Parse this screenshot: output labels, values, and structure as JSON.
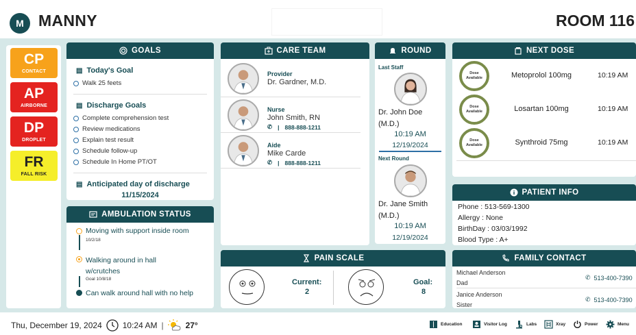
{
  "header": {
    "avatar_letter": "M",
    "patient_name": "MANNY",
    "room": "ROOM 116"
  },
  "flags": [
    {
      "code": "CP",
      "label": "CONTACT",
      "bg": "#f7a21b",
      "fg": "#ffffff"
    },
    {
      "code": "AP",
      "label": "AIRBORNE",
      "bg": "#e42320",
      "fg": "#ffffff"
    },
    {
      "code": "DP",
      "label": "DROPLET",
      "bg": "#e42320",
      "fg": "#ffffff"
    },
    {
      "code": "FR",
      "label": "FALL RISK",
      "bg": "#f5ee2a",
      "fg": "#222222"
    }
  ],
  "goals": {
    "title": "GOALS",
    "today_title": "Today's Goal",
    "today_items": [
      "Walk 25 feets"
    ],
    "discharge_title": "Discharge Goals",
    "discharge_items": [
      "Complete comprehension test",
      "Review medications",
      "Explain test result",
      "Schedule follow-up",
      "Schedule In Home PT/OT"
    ],
    "anticipated_title": "Anticipated day of discharge",
    "anticipated_date": "11/15/2024"
  },
  "ambulation": {
    "title": "AMBULATION STATUS",
    "items": [
      {
        "text": "Moving with support inside room",
        "sub": "10/2/18"
      },
      {
        "text": "Walking around in hall w/crutches",
        "sub": "Goal 10/8/18"
      },
      {
        "text": "Can walk around hall with no help",
        "sub": ""
      }
    ]
  },
  "care_team": {
    "title": "CARE TEAM",
    "members": [
      {
        "role": "Provider",
        "name": "Dr. Gardner, M.D.",
        "phone": ""
      },
      {
        "role": "Nurse",
        "name": "John Smith, RN",
        "phone": "888-888-1211"
      },
      {
        "role": "Aide",
        "name": "Mike Carde",
        "phone": "888-888-1211"
      }
    ]
  },
  "round": {
    "title": "ROUND",
    "last_label": "Last Staff",
    "last_name": "Dr. John Doe (M.D.)",
    "last_time": "10:19 AM",
    "last_date": "12/19/2024",
    "next_label": "Next Round",
    "next_name": "Dr. Jane Smith (M.D.)",
    "next_time": "10:19 AM",
    "next_date": "12/19/2024"
  },
  "next_dose": {
    "title": "NEXT DOSE",
    "ring_text": "Dose Available",
    "doses": [
      {
        "name": "Metoprolol 100mg",
        "time": "10:19 AM"
      },
      {
        "name": "Losartan 100mg",
        "time": "10:19 AM"
      },
      {
        "name": "Synthroid 75mg",
        "time": "10:19 AM"
      }
    ]
  },
  "patient_info": {
    "title": "PATIENT INFO",
    "lines": [
      "Phone : 513-569-1300",
      "Allergy : None",
      "BirthDay : 03/03/1992",
      "Blood Type : A+"
    ]
  },
  "pain": {
    "title": "PAIN SCALE",
    "current_label": "Current:",
    "current_value": "2",
    "goal_label": "Goal:",
    "goal_value": "8"
  },
  "family": {
    "title": "FAMILY CONTACT",
    "contacts": [
      {
        "name": "Michael Anderson",
        "relation": "Dad",
        "phone": "513-400-7390"
      },
      {
        "name": "Janice Anderson",
        "relation": "Sister",
        "phone": "513-400-7390"
      }
    ]
  },
  "footer": {
    "datetime": "Thu, December 19, 2024",
    "time": "10:24 AM",
    "separator": "|",
    "temp": "27°",
    "buttons": [
      "Education",
      "Visitor Log",
      "Labs",
      "Xray",
      "Power",
      "Menu"
    ]
  },
  "colors": {
    "primary": "#174d54",
    "background": "#d6e8e8",
    "dose_ring": "#7a8c4a"
  }
}
